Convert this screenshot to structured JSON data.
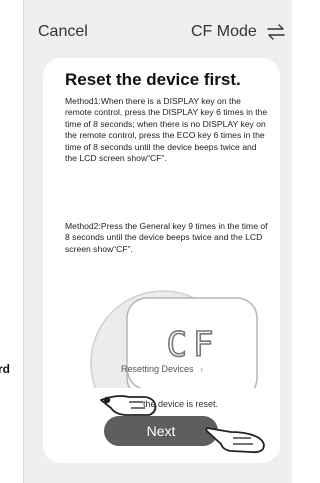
{
  "side_label": "rd",
  "header": {
    "cancel_label": "Cancel",
    "title": "CF Mode",
    "switch_icon": "swap-icon"
  },
  "card": {
    "heading": "Reset the device first.",
    "method1": "Method1:When there is a DISPLAY key on the remote control, press the DISPLAY key 6 times in the time of 8 seconds; when there is no DISPLAY key on the remote control, press the ECO key 6 times in the time of 8 seconds until the device beeps twice and the LCD screen show“CF”.",
    "method2": "Method2:Press the General key 9 times in the time of 8 seconds until the device beeps twice and the LCD screen show“CF”.",
    "display_code": "CF",
    "resetting_link": "Resetting Devices",
    "resetting_chevron": "›",
    "confirm_note": "the device is reset.",
    "next_label": "Next"
  },
  "colors": {
    "background": "#efefef",
    "card": "#ffffff",
    "button": "#5e5e5e"
  }
}
